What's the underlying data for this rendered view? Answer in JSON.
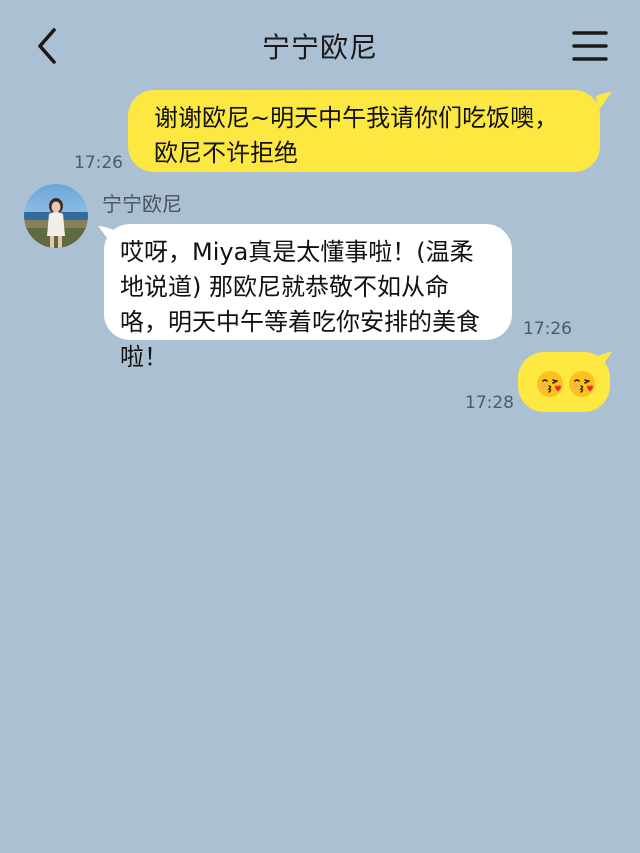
{
  "header": {
    "title": "宁宁欧尼",
    "back_icon": "chevron-left-icon",
    "menu_icon": "hamburger-menu-icon"
  },
  "messages": [
    {
      "from": "me",
      "text": "谢谢欧尼~明天中午我请你们吃饭噢，欧尼不许拒绝",
      "time": "17:26"
    },
    {
      "from": "other",
      "sender": "宁宁欧尼",
      "text": "哎呀，Miya真是太懂事啦！(温柔地说道) 那欧尼就恭敬不如从命咯，明天中午等着吃你安排的美食啦！",
      "time": "17:26"
    },
    {
      "from": "me",
      "emojis": [
        "kissing-face-heart-icon",
        "kissing-face-heart-icon"
      ],
      "time": "17:28"
    }
  ],
  "colors": {
    "background": "#abc0d3",
    "my_bubble": "#fde842",
    "other_bubble": "#ffffff"
  }
}
